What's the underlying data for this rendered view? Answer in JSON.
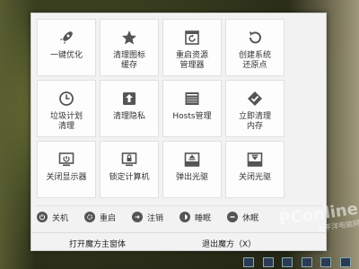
{
  "tiles": [
    {
      "label": "一键优化",
      "icon": "rocket-icon"
    },
    {
      "label": "清理图标\n缓存",
      "icon": "star-icon"
    },
    {
      "label": "重启资源\n管理器",
      "icon": "refresh-window-icon"
    },
    {
      "label": "创建系统\n还原点",
      "icon": "restore-icon"
    },
    {
      "label": "垃圾计划\n清理",
      "icon": "clock-icon"
    },
    {
      "label": "清理隐私",
      "icon": "privacy-icon"
    },
    {
      "label": "Hosts管理",
      "icon": "hosts-icon"
    },
    {
      "label": "立即清理\n内存",
      "icon": "memory-clean-icon"
    },
    {
      "label": "关闭显示器",
      "icon": "monitor-icon"
    },
    {
      "label": "锁定计算机",
      "icon": "lock-icon"
    },
    {
      "label": "弹出光驱",
      "icon": "eject-icon"
    },
    {
      "label": "关闭光驱",
      "icon": "close-drive-icon"
    }
  ],
  "power": [
    {
      "label": "关机",
      "icon": "power-icon"
    },
    {
      "label": "重启",
      "icon": "restart-icon"
    },
    {
      "label": "注销",
      "icon": "logoff-icon"
    },
    {
      "label": "睡眠",
      "icon": "sleep-icon"
    },
    {
      "label": "休眠",
      "icon": "hibernate-icon"
    }
  ],
  "bottom": {
    "open_label": "打开魔方主窗体",
    "exit_label": "退出魔方（X）"
  },
  "watermark": {
    "brand": "PConline",
    "sub": "太平洋电脑网"
  }
}
